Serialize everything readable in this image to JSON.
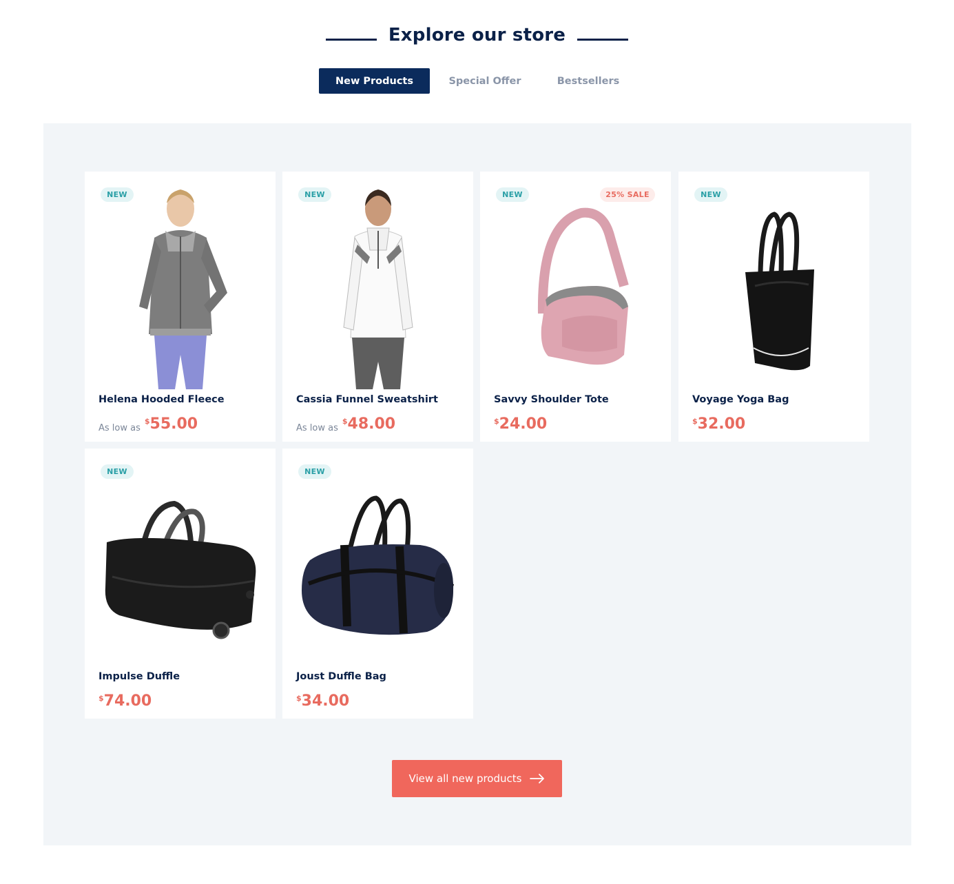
{
  "section": {
    "title": "Explore our store"
  },
  "tabs": [
    {
      "label": "New Products",
      "active": true
    },
    {
      "label": "Special Offer",
      "active": false
    },
    {
      "label": "Bestsellers",
      "active": false
    }
  ],
  "products": [
    {
      "name": "Helena Hooded Fleece",
      "price_prefix": "As low as",
      "currency": "$",
      "price": "55.00",
      "badge": "NEW",
      "image_icon": "woman-hooded-fleece-image"
    },
    {
      "name": "Cassia Funnel Sweatshirt",
      "price_prefix": "As low as",
      "currency": "$",
      "price": "48.00",
      "badge": "NEW",
      "image_icon": "woman-sweatshirt-image"
    },
    {
      "name": "Savvy Shoulder Tote",
      "price_prefix": "",
      "currency": "$",
      "price": "24.00",
      "badge": "NEW",
      "sale_badge": "25% SALE",
      "image_icon": "pink-tote-bag-image"
    },
    {
      "name": "Voyage Yoga Bag",
      "price_prefix": "",
      "currency": "$",
      "price": "32.00",
      "badge": "NEW",
      "image_icon": "black-yoga-bag-image"
    },
    {
      "name": "Impulse Duffle",
      "price_prefix": "",
      "currency": "$",
      "price": "74.00",
      "badge": "NEW",
      "image_icon": "black-rolling-duffle-image"
    },
    {
      "name": "Joust Duffle Bag",
      "price_prefix": "",
      "currency": "$",
      "price": "34.00",
      "badge": "NEW",
      "image_icon": "navy-duffle-bag-image"
    }
  ],
  "cta": {
    "label": "View all new products"
  },
  "colors": {
    "navy": "#0b2b5c",
    "accent": "#f0675c",
    "price": "#e86b5f",
    "teal": "#2a9fa6",
    "panel": "#f2f5f8"
  }
}
